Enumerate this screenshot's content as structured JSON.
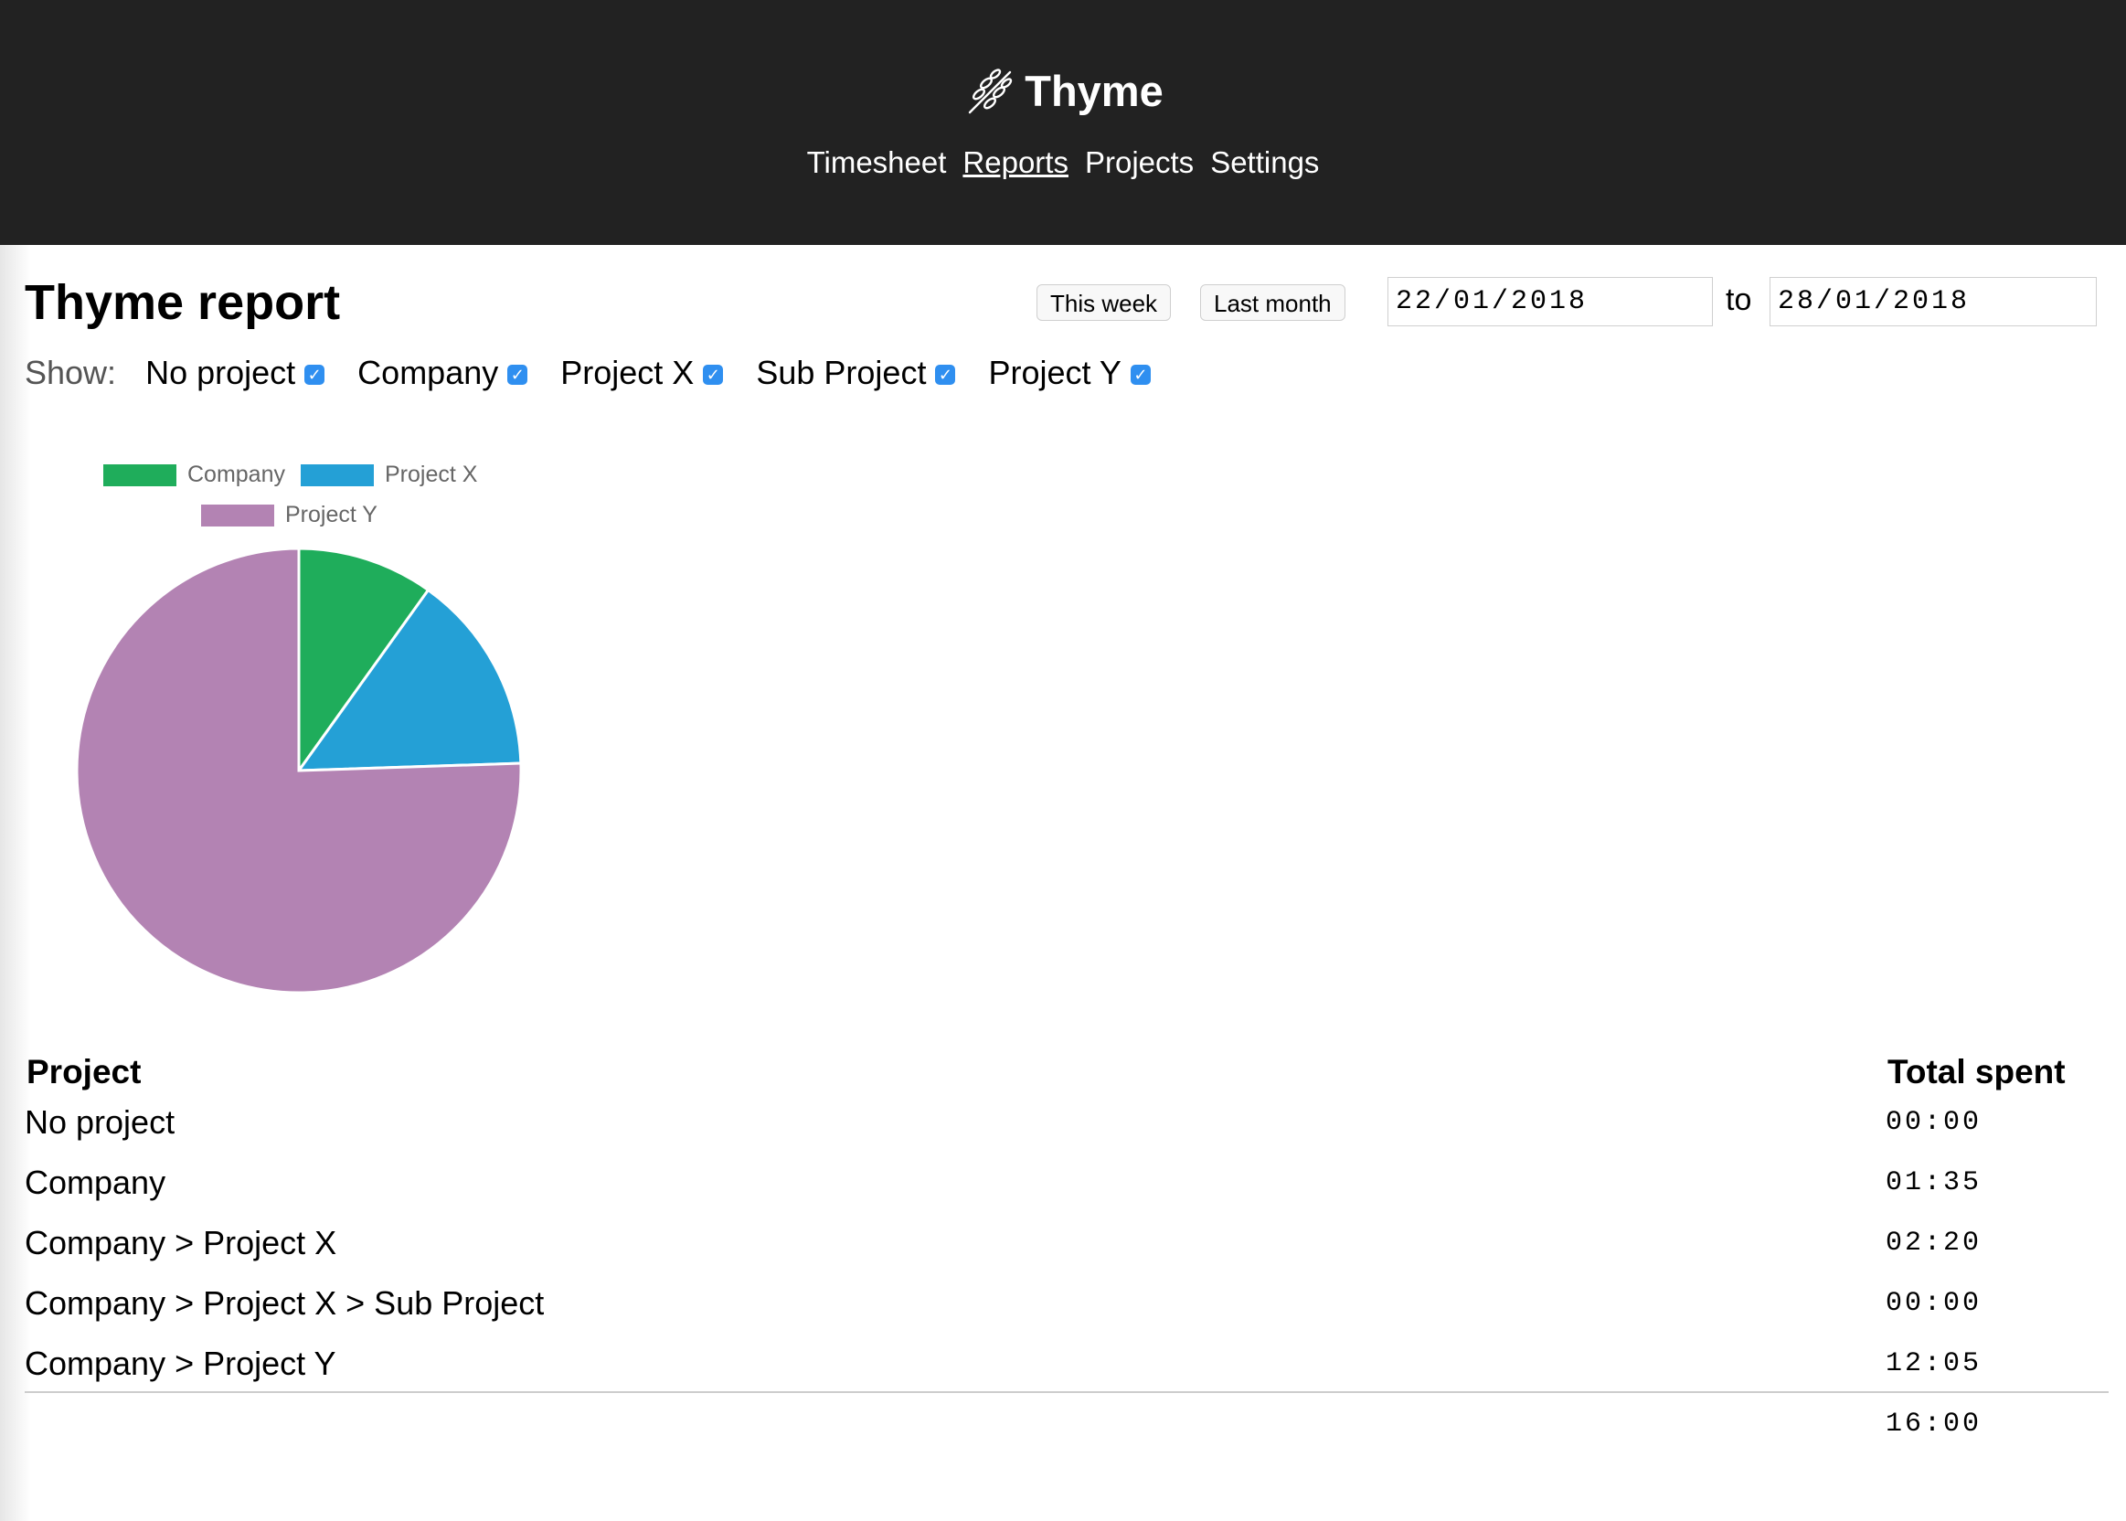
{
  "header": {
    "app_name": "Thyme",
    "logo_icon": "thyme-sprig-icon",
    "nav": [
      {
        "label": "Timesheet",
        "active": false
      },
      {
        "label": "Reports",
        "active": true
      },
      {
        "label": "Projects",
        "active": false
      },
      {
        "label": "Settings",
        "active": false
      }
    ]
  },
  "report": {
    "title": "Thyme report",
    "this_week_label": "This week",
    "last_month_label": "Last month",
    "from_date": "22/01/2018",
    "to_label": "to",
    "to_date": "28/01/2018"
  },
  "filters": {
    "show_label": "Show:",
    "items": [
      {
        "label": "No project",
        "checked": true
      },
      {
        "label": "Company",
        "checked": true
      },
      {
        "label": "Project X",
        "checked": true
      },
      {
        "label": "Sub Project",
        "checked": true
      },
      {
        "label": "Project Y",
        "checked": true
      }
    ],
    "check_glyph": "✓"
  },
  "chart_data": {
    "type": "pie",
    "legend_position": "top",
    "series": [
      {
        "name": "Company",
        "value": 95,
        "color": "#1fad5b"
      },
      {
        "name": "Project X",
        "value": 140,
        "color": "#24a0d6"
      },
      {
        "name": "Project Y",
        "value": 725,
        "color": "#b383b3"
      }
    ]
  },
  "table": {
    "col_project": "Project",
    "col_total": "Total spent",
    "rows": [
      {
        "project": "No project",
        "total": "00:00"
      },
      {
        "project": "Company",
        "total": "01:35"
      },
      {
        "project": "Company > Project X",
        "total": "02:20"
      },
      {
        "project": "Company > Project X > Sub Project",
        "total": "00:00"
      },
      {
        "project": "Company > Project Y",
        "total": "12:05"
      }
    ],
    "grand_total": "16:00"
  }
}
